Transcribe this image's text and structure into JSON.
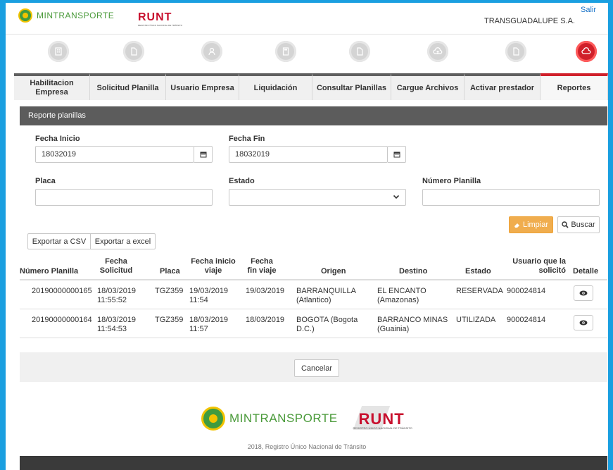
{
  "header": {
    "mintransporte_label": "MINTRANSPORTE",
    "runt_label": "RUNT",
    "runt_subtitle": "REGISTRO ÚNICO NACIONAL DE TRÁNSITO",
    "company": "TRANSGUADALUPE S.A.",
    "logout": "Salir"
  },
  "nav_icons": [
    "building-icon",
    "document-icon",
    "user-icon",
    "calculator-icon",
    "search-document-icon",
    "cloud-upload-icon",
    "document-check-icon",
    "report-icon"
  ],
  "tabs": [
    {
      "label": "Habilitacion Empresa",
      "active": false
    },
    {
      "label": "Solicitud Planilla",
      "active": false
    },
    {
      "label": "Usuario Empresa",
      "active": false
    },
    {
      "label": "Liquidación",
      "active": false
    },
    {
      "label": "Consultar Planillas",
      "active": false
    },
    {
      "label": "Cargue Archivos",
      "active": false
    },
    {
      "label": "Activar prestador",
      "active": false
    },
    {
      "label": "Reportes",
      "active": true
    }
  ],
  "section_title": "Reporte planillas",
  "form": {
    "fecha_inicio_label": "Fecha Inicio",
    "fecha_inicio_value": "18032019",
    "fecha_fin_label": "Fecha Fin",
    "fecha_fin_value": "18032019",
    "placa_label": "Placa",
    "placa_value": "",
    "estado_label": "Estado",
    "estado_value": "",
    "numero_planilla_label": "Número Planilla",
    "numero_planilla_value": "",
    "limpiar": "Limpiar",
    "buscar": "Buscar"
  },
  "export": {
    "csv": "Exportar a CSV",
    "excel": "Exportar a excel"
  },
  "table": {
    "headers": {
      "numero_planilla": "Número Planilla",
      "fecha_solicitud": "Fecha Solicitud",
      "placa": "Placa",
      "fecha_inicio_viaje": "Fecha inicio viaje",
      "fecha_fin_viaje": "Fecha fin viaje",
      "origen": "Origen",
      "destino": "Destino",
      "estado": "Estado",
      "usuario": "Usuario que la solicitó",
      "detalle": "Detalle"
    },
    "rows": [
      {
        "numero_planilla": "20190000000165",
        "fecha_solicitud_1": "18/03/2019",
        "fecha_solicitud_2": "11:55:52",
        "placa": "TGZ359",
        "fecha_inicio_1": "19/03/2019",
        "fecha_inicio_2": "11:54",
        "fecha_fin": "19/03/2019",
        "origen_1": "BARRANQUILLA",
        "origen_2": "(Atlantico)",
        "destino_1": "EL ENCANTO",
        "destino_2": "(Amazonas)",
        "estado": "RESERVADA",
        "usuario": "900024814"
      },
      {
        "numero_planilla": "20190000000164",
        "fecha_solicitud_1": "18/03/2019",
        "fecha_solicitud_2": "11:54:53",
        "placa": "TGZ359",
        "fecha_inicio_1": "18/03/2019",
        "fecha_inicio_2": "11:57",
        "fecha_fin": "18/03/2019",
        "origen_1": "BOGOTA (Bogota",
        "origen_2": "D.C.)",
        "destino_1": "BARRANCO MINAS",
        "destino_2": "(Guainia)",
        "estado": "UTILIZADA",
        "usuario": "900024814"
      }
    ]
  },
  "cancelar": "Cancelar",
  "footer": {
    "mintransporte_label": "MINTRANSPORTE",
    "runt_label": "RUNT",
    "runt_subtitle": "REGISTRO ÚNICO NACIONAL DE TRÁNSITO",
    "copyright": "2018, Registro Único Nacional de Tránsito"
  },
  "colors": {
    "accent": "#1a9fe0",
    "active_tab": "#d0202a",
    "limpiar_button": "#f0ad4e",
    "section_bar": "#5c5c5c"
  }
}
